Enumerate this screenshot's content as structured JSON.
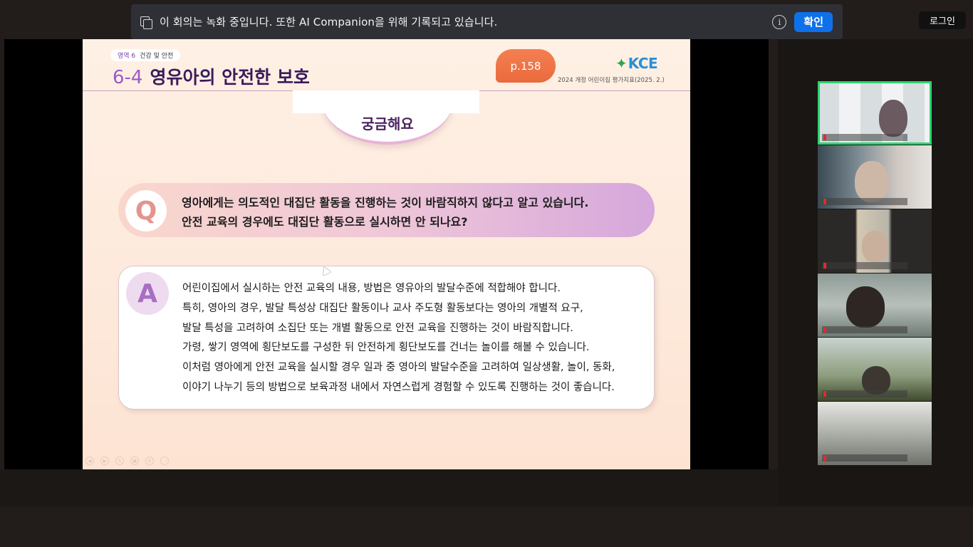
{
  "banner": {
    "message": "이 회의는 녹화 중입니다. 또한 AI Companion을 위해 기록되고 있습니다.",
    "confirm_label": "확인",
    "info_icon": "info-icon",
    "copy_icon": "copy-icon"
  },
  "top_right": {
    "login_label": "로그인"
  },
  "slide": {
    "area_num": "영역 6",
    "area_name": "건강 및 안전",
    "section_num": "6-4",
    "title": "영유아의 안전한 보호",
    "page_ref": "p.158",
    "logo_text": "KCE",
    "logo_caption": "2024 개정 어린이집 평가지표(2025. 2.)",
    "curious_label": "궁금해요",
    "q_letter": "Q",
    "q_lines": [
      "영아에게는 의도적인 대집단 활동을 진행하는 것이 바람직하지 않다고 알고 있습니다.",
      "안전 교육의 경우에도 대집단 활동으로 실시하면 안 되나요?"
    ],
    "a_letter": "A",
    "a_lines": [
      "어린이집에서 실시하는 안전 교육의 내용, 방법은 영유아의 발달수준에 적합해야 합니다.",
      "특히, 영아의 경우, 발달 특성상 대집단 활동이나 교사 주도형 활동보다는 영아의 개별적 요구,",
      "발달 특성을 고려하여 소집단 또는 개별 활동으로 안전 교육을 진행하는 것이 바람직합니다.",
      "가령, 쌓기 영역에 횡단보도를 구성한 뒤 안전하게 횡단보도를 건너는 놀이를 해볼 수 있습니다.",
      "이처럼 영아에게 안전 교육을 실시할 경우 일과 중 영아의 발달수준을 고려하여 일상생활, 놀이, 동화,",
      "이야기 나누기 등의 방법으로 보육과정 내에서 자연스럽게 경험할 수 있도록 진행하는 것이 좋습니다."
    ]
  },
  "colors": {
    "accent_blue": "#0e71eb",
    "active_speaker": "#2bd670",
    "page_pill": "#ea6a3d",
    "title_purple": "#3b1a5c"
  }
}
